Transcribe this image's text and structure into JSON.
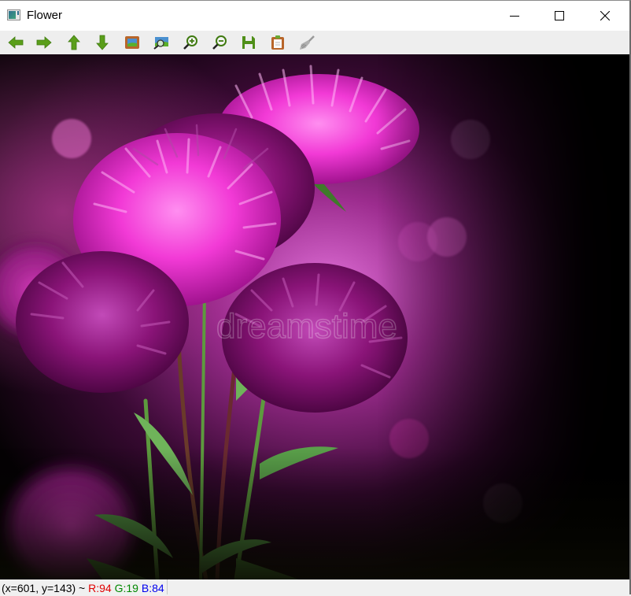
{
  "window": {
    "title": "Flower",
    "app_icon": "image-window-icon",
    "controls": [
      {
        "name": "minimize-button",
        "icon": "minimize-icon"
      },
      {
        "name": "maximize-button",
        "icon": "maximize-icon"
      },
      {
        "name": "close-button",
        "icon": "close-icon"
      }
    ]
  },
  "toolbar": {
    "buttons": [
      {
        "name": "pan-left-button",
        "icon": "arrow-left-icon"
      },
      {
        "name": "pan-right-button",
        "icon": "arrow-right-icon"
      },
      {
        "name": "pan-up-button",
        "icon": "arrow-up-icon"
      },
      {
        "name": "pan-down-button",
        "icon": "arrow-down-icon"
      },
      {
        "name": "zoom-fit-button",
        "icon": "image-frame-icon"
      },
      {
        "name": "zoom-original-button",
        "icon": "image-magnifier-icon"
      },
      {
        "name": "zoom-in-button",
        "icon": "zoom-in-icon"
      },
      {
        "name": "zoom-out-button",
        "icon": "zoom-out-icon"
      },
      {
        "name": "save-button",
        "icon": "save-icon"
      },
      {
        "name": "copy-clipboard-button",
        "icon": "clipboard-icon"
      },
      {
        "name": "properties-button",
        "icon": "brush-icon"
      }
    ],
    "accent_green": "#5a9e1a",
    "accent_brown": "#b8662a"
  },
  "image": {
    "description": "Pink and purple aster flowers on dark magenta bokeh background",
    "watermark": "dreamstime"
  },
  "status": {
    "coords": "(x=601, y=143) ~ ",
    "r_label": "R:94",
    "g_label": "G:19",
    "b_label": "B:84",
    "r_color": "#e00000",
    "g_color": "#008800",
    "b_color": "#0000ee"
  }
}
